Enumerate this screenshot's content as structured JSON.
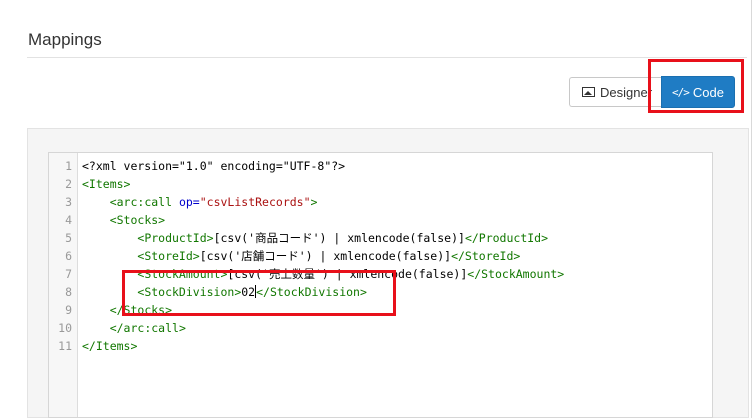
{
  "page": {
    "title": "Mappings"
  },
  "toolbar": {
    "designer_label": "Designer",
    "designer_icon": "image-icon",
    "code_label": "Code",
    "code_icon": "</>",
    "code_active_color": "#1f7cc4"
  },
  "editor": {
    "lines": [
      {
        "n": "1",
        "parts": [
          [
            "plain",
            "<?xml version=\"1.0\" encoding=\"UTF-8\"?>"
          ]
        ]
      },
      {
        "n": "2",
        "parts": [
          [
            "tag-name",
            "<Items>"
          ]
        ]
      },
      {
        "n": "3",
        "parts": [
          [
            "plain",
            "    "
          ],
          [
            "tag-name",
            "<arc:call "
          ],
          [
            "attr",
            "op="
          ],
          [
            "str",
            "\"csvListRecords\""
          ],
          [
            "tag-name",
            ">"
          ]
        ]
      },
      {
        "n": "4",
        "parts": [
          [
            "plain",
            "    "
          ],
          [
            "tag-name",
            "<Stocks>"
          ]
        ]
      },
      {
        "n": "5",
        "parts": [
          [
            "plain",
            "        "
          ],
          [
            "tag-name",
            "<ProductId>"
          ],
          [
            "plain",
            "[csv('商品コード') | xmlencode(false)]"
          ],
          [
            "tag-name",
            "</ProductId>"
          ]
        ]
      },
      {
        "n": "6",
        "parts": [
          [
            "plain",
            "        "
          ],
          [
            "tag-name",
            "<StoreId>"
          ],
          [
            "plain",
            "[csv('店舗コード') | xmlencode(false)]"
          ],
          [
            "tag-name",
            "</StoreId>"
          ]
        ]
      },
      {
        "n": "7",
        "parts": [
          [
            "plain",
            "        "
          ],
          [
            "tag-name",
            "<StockAmount>"
          ],
          [
            "plain",
            "[csv('売上数量') | xmlencode(false)]"
          ],
          [
            "tag-name",
            "</StockAmount>"
          ]
        ]
      },
      {
        "n": "8",
        "parts": [
          [
            "plain",
            "        "
          ],
          [
            "tag-name",
            "<StockDivision>"
          ],
          [
            "plain",
            "02"
          ],
          [
            "cursor",
            ""
          ],
          [
            "tag-name",
            "</StockDivision>"
          ]
        ]
      },
      {
        "n": "9",
        "parts": [
          [
            "plain",
            "    "
          ],
          [
            "tag-name",
            "</Stocks>"
          ]
        ]
      },
      {
        "n": "10",
        "parts": [
          [
            "plain",
            "    "
          ],
          [
            "tag-name",
            "</arc:call>"
          ]
        ]
      },
      {
        "n": "11",
        "parts": [
          [
            "tag-name",
            "</Items>"
          ]
        ]
      }
    ]
  },
  "colors": {
    "highlight": "#e8101a",
    "tag": "#117700",
    "attr": "#0000cc",
    "string": "#aa1111"
  }
}
